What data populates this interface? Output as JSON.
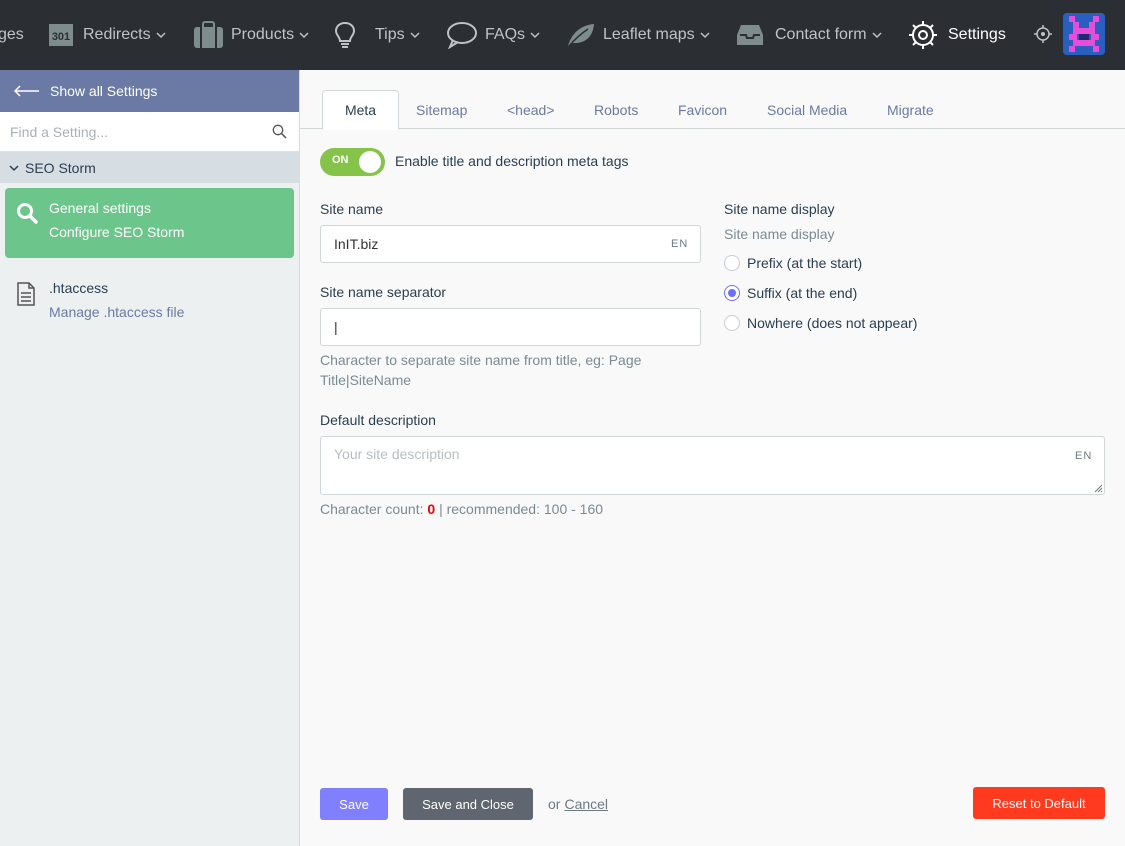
{
  "topnav": {
    "items": [
      {
        "label": "ges",
        "icon": "pages-icon"
      },
      {
        "label": "Redirects",
        "icon": "redirect-301-icon"
      },
      {
        "label": "Products",
        "icon": "briefcase-icon"
      },
      {
        "label": "Tips",
        "icon": "lightbulb-icon"
      },
      {
        "label": "FAQs",
        "icon": "chat-bubble-icon"
      },
      {
        "label": "Leaflet maps",
        "icon": "leaf-icon"
      },
      {
        "label": "Contact form",
        "icon": "inbox-icon"
      },
      {
        "label": "Settings",
        "icon": "gear-icon"
      }
    ],
    "badge_301": "301"
  },
  "sidebar": {
    "show_all": "Show all Settings",
    "search_placeholder": "Find a Setting...",
    "group": "SEO Storm",
    "items": [
      {
        "title": "General settings",
        "desc": "Configure SEO Storm",
        "icon": "search-icon"
      },
      {
        "title": ".htaccess",
        "desc": "Manage .htaccess file",
        "icon": "document-icon"
      }
    ]
  },
  "tabs": [
    "Meta",
    "Sitemap",
    "<head>",
    "Robots",
    "Favicon",
    "Social Media",
    "Migrate"
  ],
  "form": {
    "toggle_state": "ON",
    "toggle_label": "Enable title and description meta tags",
    "site_name_label": "Site name",
    "site_name_value": "InIT.biz",
    "lang": "EN",
    "separator_label": "Site name separator",
    "separator_value": "|",
    "separator_help": "Character to separate site name from title, eg: Page Title|SiteName",
    "display_label": "Site name display",
    "display_comment": "Site name display",
    "display_options": [
      {
        "label": "Prefix (at the start)",
        "checked": false
      },
      {
        "label": "Suffix (at the end)",
        "checked": true
      },
      {
        "label": "Nowhere (does not appear)",
        "checked": false
      }
    ],
    "description_label": "Default description",
    "description_placeholder": "Your site description",
    "char_count_prefix": "Character count:",
    "char_count_value": "0",
    "char_count_suffix": "| recommended: 100 - 160"
  },
  "buttons": {
    "save": "Save",
    "save_close": "Save and Close",
    "or": "or",
    "cancel": "Cancel",
    "reset": "Reset to Default"
  },
  "colors": {
    "topnav_bg": "#2b2f33",
    "sidebar_header": "#6a7aa5",
    "active_item": "#6cc58a",
    "toggle_on": "#86c34b",
    "primary": "#8080ff",
    "danger": "#ff3a1f"
  }
}
